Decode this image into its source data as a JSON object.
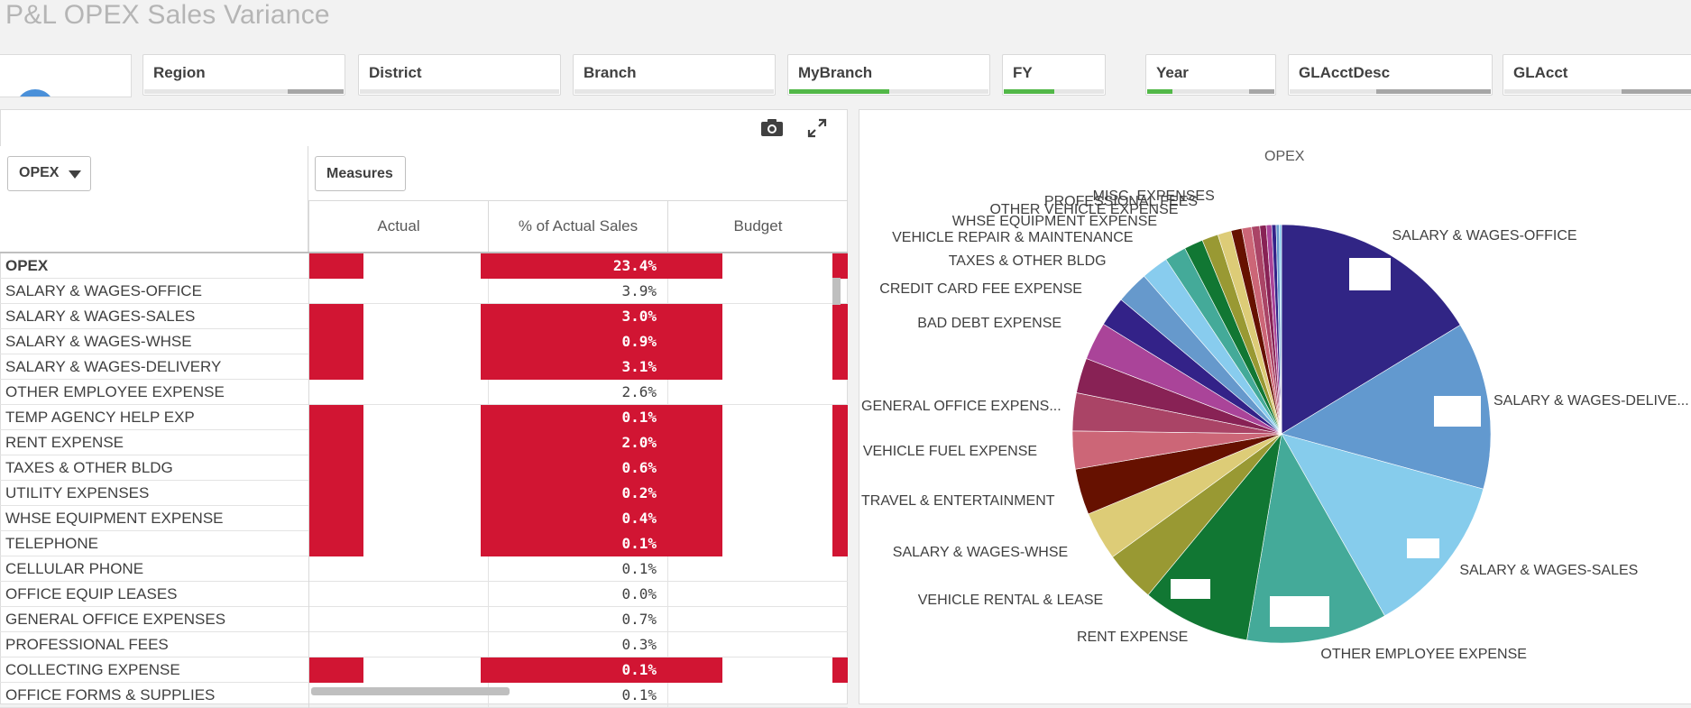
{
  "app_title": "P&L OPEX Sales Variance",
  "filters": [
    {
      "label": "Region",
      "green": 0,
      "gray": 0.28
    },
    {
      "label": "District",
      "green": 0,
      "gray": 0
    },
    {
      "label": "Branch",
      "green": 0,
      "gray": 0
    },
    {
      "label": "MyBranch",
      "green": 0.5,
      "gray": 0
    },
    {
      "label": "FY",
      "green": 0.5,
      "gray": 0
    },
    {
      "label": "Year",
      "green": 0.2,
      "gray": 0.2
    },
    {
      "label": "GLAcctDesc",
      "green": 0,
      "gray": 0.57
    },
    {
      "label": "GLAcct",
      "green": 0,
      "gray": 0.45
    }
  ],
  "table": {
    "dimension_button": "OPEX",
    "measures_button": "Measures",
    "columns": [
      "Actual",
      "% of Actual Sales",
      "Budget"
    ],
    "rows": [
      {
        "label": "OPEX",
        "pct": "23.4%",
        "red": true,
        "bold": true
      },
      {
        "label": "SALARY & WAGES-OFFICE",
        "pct": "3.9%",
        "red": false
      },
      {
        "label": "SALARY & WAGES-SALES",
        "pct": "3.0%",
        "red": true
      },
      {
        "label": "SALARY & WAGES-WHSE",
        "pct": "0.9%",
        "red": true
      },
      {
        "label": "SALARY & WAGES-DELIVERY",
        "pct": "3.1%",
        "red": true
      },
      {
        "label": "OTHER EMPLOYEE EXPENSE",
        "pct": "2.6%",
        "red": false
      },
      {
        "label": "TEMP AGENCY HELP EXP",
        "pct": "0.1%",
        "red": true
      },
      {
        "label": "RENT EXPENSE",
        "pct": "2.0%",
        "red": true
      },
      {
        "label": "TAXES & OTHER BLDG",
        "pct": "0.6%",
        "red": true
      },
      {
        "label": "UTILITY EXPENSES",
        "pct": "0.2%",
        "red": true
      },
      {
        "label": "WHSE EQUIPMENT EXPENSE",
        "pct": "0.4%",
        "red": true
      },
      {
        "label": "TELEPHONE",
        "pct": "0.1%",
        "red": true
      },
      {
        "label": "CELLULAR PHONE",
        "pct": "0.1%",
        "red": false
      },
      {
        "label": "OFFICE EQUIP LEASES",
        "pct": "0.0%",
        "red": false
      },
      {
        "label": "GENERAL OFFICE EXPENSES",
        "pct": "0.7%",
        "red": false
      },
      {
        "label": "PROFESSIONAL FEES",
        "pct": "0.3%",
        "red": false
      },
      {
        "label": "COLLECTING EXPENSE",
        "pct": "0.1%",
        "red": true
      },
      {
        "label": "OFFICE FORMS & SUPPLIES",
        "pct": "0.1%",
        "red": false
      }
    ]
  },
  "chart_data": {
    "type": "pie",
    "title": "OPEX",
    "slices": [
      {
        "label": "SALARY & WAGES-OFFICE",
        "value": 3.9,
        "color": "#312585"
      },
      {
        "label": "SALARY & WAGES-DELIVE...",
        "value": 3.1,
        "color": "#6299cf"
      },
      {
        "label": "SALARY & WAGES-SALES",
        "value": 3.0,
        "color": "#86ccec"
      },
      {
        "label": "OTHER EMPLOYEE EXPENSE",
        "value": 2.6,
        "color": "#44aa99"
      },
      {
        "label": "RENT EXPENSE",
        "value": 2.0,
        "color": "#117733"
      },
      {
        "label": "VEHICLE RENTAL & LEASE",
        "value": 0.95,
        "color": "#999933"
      },
      {
        "label": "SALARY & WAGES-WHSE",
        "value": 0.9,
        "color": "#ddcc77"
      },
      {
        "label": "TRAVEL & ENTERTAINMENT",
        "value": 0.85,
        "color": "#661100"
      },
      {
        "label": "VEHICLE FUEL EXPENSE",
        "value": 0.7,
        "color": "#cc6677"
      },
      {
        "label": "GENERAL OFFICE EXPENS...",
        "value": 0.7,
        "color": "#aa4466"
      },
      {
        "label": "",
        "value": 0.65,
        "color": "#882255"
      },
      {
        "label": "BAD DEBT EXPENSE",
        "value": 0.7,
        "color": "#aa4499"
      },
      {
        "label": "CREDIT CARD FEE EXPENSE",
        "value": 0.55,
        "color": "#332288"
      },
      {
        "label": "TAXES & OTHER BLDG",
        "value": 0.6,
        "color": "#6699cc"
      },
      {
        "label": "VEHICLE REPAIR & MAINTENANCE",
        "value": 0.5,
        "color": "#88ccee"
      },
      {
        "label": "WHSE EQUIPMENT EXPENSE",
        "value": 0.4,
        "color": "#44aa99"
      },
      {
        "label": "OTHER VEHICLE EXPENSE",
        "value": 0.35,
        "color": "#117733"
      },
      {
        "label": "PROFESSIONAL FEES",
        "value": 0.3,
        "color": "#999933"
      },
      {
        "label": "MISC. EXPENSES",
        "value": 0.25,
        "color": "#ddcc77"
      },
      {
        "label": "",
        "value": 0.2,
        "color": "#661100"
      },
      {
        "label": "",
        "value": 0.18,
        "color": "#cc6677"
      },
      {
        "label": "",
        "value": 0.15,
        "color": "#aa4466"
      },
      {
        "label": "",
        "value": 0.12,
        "color": "#882255"
      },
      {
        "label": "",
        "value": 0.1,
        "color": "#aa4499"
      },
      {
        "label": "",
        "value": 0.08,
        "color": "#332288"
      },
      {
        "label": "",
        "value": 0.06,
        "color": "#6699cc"
      },
      {
        "label": "",
        "value": 0.04,
        "color": "#88ccee"
      }
    ]
  }
}
